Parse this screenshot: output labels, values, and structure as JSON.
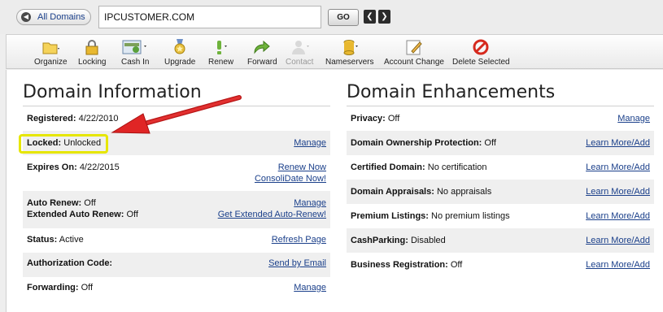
{
  "topbar": {
    "all_domains_label": "All Domains",
    "domain_value": "IPCUSTOMER.COM",
    "go_label": "GO",
    "prev_glyph": "❮",
    "next_glyph": "❯"
  },
  "toolbar": {
    "items": [
      {
        "label": "Organize",
        "icon": "folder-icon"
      },
      {
        "label": "Locking",
        "icon": "lock-icon"
      },
      {
        "label": "Cash In",
        "icon": "cash-in-icon"
      },
      {
        "label": "Upgrade",
        "icon": "medal-icon"
      },
      {
        "label": "Renew",
        "icon": "renew-icon"
      },
      {
        "label": "Forward",
        "icon": "forward-arrow-icon"
      },
      {
        "label": "Contact",
        "icon": "contact-icon"
      },
      {
        "label": "Nameservers",
        "icon": "database-icon"
      },
      {
        "label": "Account Change",
        "icon": "edit-icon"
      },
      {
        "label": "Delete Selected",
        "icon": "delete-icon"
      }
    ]
  },
  "domain_info": {
    "title": "Domain Information",
    "registered_key": "Registered:",
    "registered_val": "4/22/2010",
    "locked_key": "Locked:",
    "locked_val": "Unlocked",
    "locked_link": "Manage",
    "expires_key": "Expires On:",
    "expires_val": "4/22/2015",
    "renew_now": "Renew Now",
    "consolidate": "ConsoliDate Now!",
    "auto_renew_key": "Auto Renew:",
    "auto_renew_val": "Off",
    "auto_renew_link": "Manage",
    "ext_auto_key": "Extended Auto Renew:",
    "ext_auto_val": "Off",
    "ext_auto_link": "Get Extended Auto-Renew!",
    "status_key": "Status:",
    "status_val": "Active",
    "status_link": "Refresh Page",
    "auth_key": "Authorization Code:",
    "auth_link": "Send by Email",
    "fwd_key": "Forwarding:",
    "fwd_val": "Off",
    "fwd_link": "Manage"
  },
  "domain_enh": {
    "title": "Domain Enhancements",
    "privacy_key": "Privacy:",
    "privacy_val": "Off",
    "privacy_link": "Manage",
    "own_key": "Domain Ownership Protection:",
    "own_val": "Off",
    "own_link": "Learn More/Add",
    "cert_key": "Certified Domain:",
    "cert_val": "No certification",
    "cert_link": "Learn More/Add",
    "appr_key": "Domain Appraisals:",
    "appr_val": "No appraisals",
    "appr_link": "Learn More/Add",
    "prem_key": "Premium Listings:",
    "prem_val": "No premium listings",
    "prem_link": "Learn More/Add",
    "cash_key": "CashParking:",
    "cash_val": "Disabled",
    "cash_link": "Learn More/Add",
    "biz_key": "Business Registration:",
    "biz_val": "Off",
    "biz_link": "Learn More/Add"
  },
  "colors": {
    "link": "#1a3f8a",
    "highlight_box": "#e6e600",
    "arrow": "#d81e1e"
  }
}
